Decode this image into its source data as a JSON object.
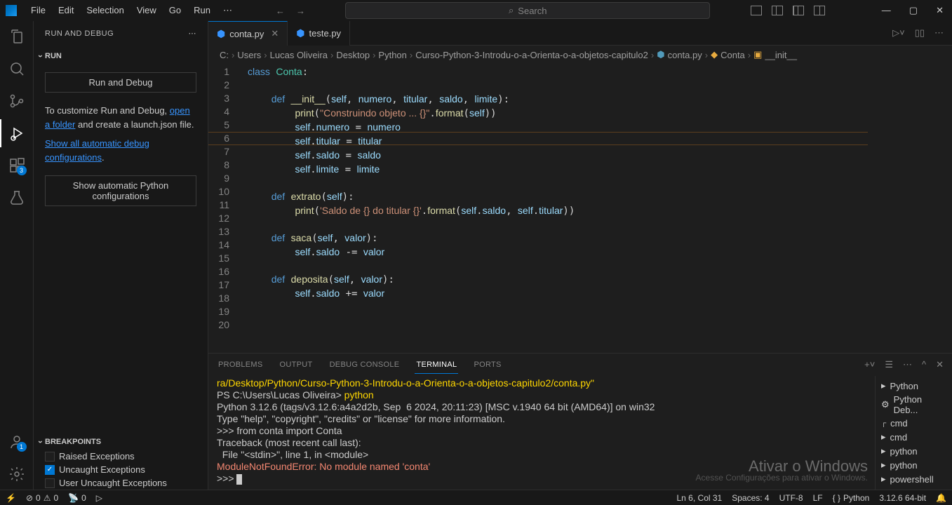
{
  "menu": {
    "file": "File",
    "edit": "Edit",
    "selection": "Selection",
    "view": "View",
    "go": "Go",
    "run": "Run"
  },
  "search_placeholder": "Search",
  "sidebar": {
    "title": "RUN AND DEBUG",
    "run_section": "RUN",
    "run_btn": "Run and Debug",
    "customize_text": "To customize Run and Debug, ",
    "open_folder": "open a folder",
    "launch_text": " and create a launch.json file.",
    "show_auto": "Show all automatic debug configurations",
    "show_python": "Show automatic Python configurations",
    "breakpoints": "BREAKPOINTS",
    "bp_raised": "Raised Exceptions",
    "bp_uncaught": "Uncaught Exceptions",
    "bp_user": "User Uncaught Exceptions"
  },
  "tabs": {
    "conta": "conta.py",
    "teste": "teste.py"
  },
  "breadcrumb": {
    "c": "C:",
    "users": "Users",
    "lucas": "Lucas Oliveira",
    "desktop": "Desktop",
    "python": "Python",
    "curso": "Curso-Python-3-Introdu-o-a-Orienta-o-a-objetos-capitulo2",
    "file": "conta.py",
    "class": "Conta",
    "method": "__init__"
  },
  "lines": [
    "1",
    "2",
    "3",
    "4",
    "5",
    "6",
    "7",
    "8",
    "9",
    "10",
    "11",
    "12",
    "13",
    "14",
    "15",
    "16",
    "17",
    "18",
    "19",
    "20"
  ],
  "panel": {
    "problems": "PROBLEMS",
    "output": "OUTPUT",
    "debug": "DEBUG CONSOLE",
    "terminal": "TERMINAL",
    "ports": "PORTS"
  },
  "terminal": {
    "l1": "ra/Desktop/Python/Curso-Python-3-Introdu-o-a-Orienta-o-a-objetos-capitulo2/conta.py\"",
    "l2_prefix": "PS C:\\Users\\Lucas Oliveira> ",
    "l2_cmd": "python",
    "l3": "Python 3.12.6 (tags/v3.12.6:a4a2d2b, Sep  6 2024, 20:11:23) [MSC v.1940 64 bit (AMD64)] on win32",
    "l4": "Type \"help\", \"copyright\", \"credits\" or \"license\" for more information.",
    "l5": ">>> from conta import Conta",
    "l6": "Traceback (most recent call last):",
    "l7": "  File \"<stdin>\", line 1, in <module>",
    "l8": "ModuleNotFoundError: No module named 'conta'",
    "l9": ">>> "
  },
  "term_list": {
    "python": "Python",
    "pydeb": "Python Deb...",
    "cmd": "cmd",
    "cmd2": "cmd",
    "py2": "python",
    "py3": "python",
    "ps": "powershell"
  },
  "status": {
    "errors": "0",
    "warnings": "0",
    "port": "0",
    "ln": "Ln 6, Col 31",
    "spaces": "Spaces: 4",
    "enc": "UTF-8",
    "eol": "LF",
    "lang": "Python",
    "ver": "3.12.6 64-bit"
  },
  "watermark": {
    "title": "Ativar o Windows",
    "sub": "Acesse Configurações para ativar o Windows."
  },
  "code": {
    "class": "class",
    "conta": "Conta",
    "def": "def",
    "init": "__init__",
    "self": "self",
    "numero": "numero",
    "titular": "titular",
    "saldo": "saldo",
    "limite": "limite",
    "print": "print",
    "str1": "\"Construindo objeto ... {}\"",
    "format": "format",
    "extrato": "extrato",
    "str2": "'Saldo de {} do titular {}'",
    "saca": "saca",
    "valor": "valor",
    "deposita": "deposita"
  }
}
